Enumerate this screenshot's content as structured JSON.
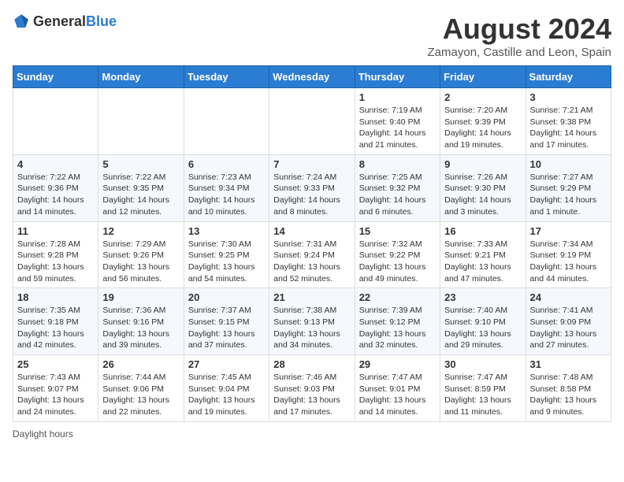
{
  "header": {
    "logo_general": "General",
    "logo_blue": "Blue",
    "month_title": "August 2024",
    "location": "Zamayon, Castille and Leon, Spain"
  },
  "days_of_week": [
    "Sunday",
    "Monday",
    "Tuesday",
    "Wednesday",
    "Thursday",
    "Friday",
    "Saturday"
  ],
  "weeks": [
    [
      {
        "day": "",
        "info": ""
      },
      {
        "day": "",
        "info": ""
      },
      {
        "day": "",
        "info": ""
      },
      {
        "day": "",
        "info": ""
      },
      {
        "day": "1",
        "info": "Sunrise: 7:19 AM\nSunset: 9:40 PM\nDaylight: 14 hours and 21 minutes."
      },
      {
        "day": "2",
        "info": "Sunrise: 7:20 AM\nSunset: 9:39 PM\nDaylight: 14 hours and 19 minutes."
      },
      {
        "day": "3",
        "info": "Sunrise: 7:21 AM\nSunset: 9:38 PM\nDaylight: 14 hours and 17 minutes."
      }
    ],
    [
      {
        "day": "4",
        "info": "Sunrise: 7:22 AM\nSunset: 9:36 PM\nDaylight: 14 hours and 14 minutes."
      },
      {
        "day": "5",
        "info": "Sunrise: 7:22 AM\nSunset: 9:35 PM\nDaylight: 14 hours and 12 minutes."
      },
      {
        "day": "6",
        "info": "Sunrise: 7:23 AM\nSunset: 9:34 PM\nDaylight: 14 hours and 10 minutes."
      },
      {
        "day": "7",
        "info": "Sunrise: 7:24 AM\nSunset: 9:33 PM\nDaylight: 14 hours and 8 minutes."
      },
      {
        "day": "8",
        "info": "Sunrise: 7:25 AM\nSunset: 9:32 PM\nDaylight: 14 hours and 6 minutes."
      },
      {
        "day": "9",
        "info": "Sunrise: 7:26 AM\nSunset: 9:30 PM\nDaylight: 14 hours and 3 minutes."
      },
      {
        "day": "10",
        "info": "Sunrise: 7:27 AM\nSunset: 9:29 PM\nDaylight: 14 hours and 1 minute."
      }
    ],
    [
      {
        "day": "11",
        "info": "Sunrise: 7:28 AM\nSunset: 9:28 PM\nDaylight: 13 hours and 59 minutes."
      },
      {
        "day": "12",
        "info": "Sunrise: 7:29 AM\nSunset: 9:26 PM\nDaylight: 13 hours and 56 minutes."
      },
      {
        "day": "13",
        "info": "Sunrise: 7:30 AM\nSunset: 9:25 PM\nDaylight: 13 hours and 54 minutes."
      },
      {
        "day": "14",
        "info": "Sunrise: 7:31 AM\nSunset: 9:24 PM\nDaylight: 13 hours and 52 minutes."
      },
      {
        "day": "15",
        "info": "Sunrise: 7:32 AM\nSunset: 9:22 PM\nDaylight: 13 hours and 49 minutes."
      },
      {
        "day": "16",
        "info": "Sunrise: 7:33 AM\nSunset: 9:21 PM\nDaylight: 13 hours and 47 minutes."
      },
      {
        "day": "17",
        "info": "Sunrise: 7:34 AM\nSunset: 9:19 PM\nDaylight: 13 hours and 44 minutes."
      }
    ],
    [
      {
        "day": "18",
        "info": "Sunrise: 7:35 AM\nSunset: 9:18 PM\nDaylight: 13 hours and 42 minutes."
      },
      {
        "day": "19",
        "info": "Sunrise: 7:36 AM\nSunset: 9:16 PM\nDaylight: 13 hours and 39 minutes."
      },
      {
        "day": "20",
        "info": "Sunrise: 7:37 AM\nSunset: 9:15 PM\nDaylight: 13 hours and 37 minutes."
      },
      {
        "day": "21",
        "info": "Sunrise: 7:38 AM\nSunset: 9:13 PM\nDaylight: 13 hours and 34 minutes."
      },
      {
        "day": "22",
        "info": "Sunrise: 7:39 AM\nSunset: 9:12 PM\nDaylight: 13 hours and 32 minutes."
      },
      {
        "day": "23",
        "info": "Sunrise: 7:40 AM\nSunset: 9:10 PM\nDaylight: 13 hours and 29 minutes."
      },
      {
        "day": "24",
        "info": "Sunrise: 7:41 AM\nSunset: 9:09 PM\nDaylight: 13 hours and 27 minutes."
      }
    ],
    [
      {
        "day": "25",
        "info": "Sunrise: 7:43 AM\nSunset: 9:07 PM\nDaylight: 13 hours and 24 minutes."
      },
      {
        "day": "26",
        "info": "Sunrise: 7:44 AM\nSunset: 9:06 PM\nDaylight: 13 hours and 22 minutes."
      },
      {
        "day": "27",
        "info": "Sunrise: 7:45 AM\nSunset: 9:04 PM\nDaylight: 13 hours and 19 minutes."
      },
      {
        "day": "28",
        "info": "Sunrise: 7:46 AM\nSunset: 9:03 PM\nDaylight: 13 hours and 17 minutes."
      },
      {
        "day": "29",
        "info": "Sunrise: 7:47 AM\nSunset: 9:01 PM\nDaylight: 13 hours and 14 minutes."
      },
      {
        "day": "30",
        "info": "Sunrise: 7:47 AM\nSunset: 8:59 PM\nDaylight: 13 hours and 11 minutes."
      },
      {
        "day": "31",
        "info": "Sunrise: 7:48 AM\nSunset: 8:58 PM\nDaylight: 13 hours and 9 minutes."
      }
    ]
  ],
  "footer": {
    "note": "Daylight hours"
  }
}
